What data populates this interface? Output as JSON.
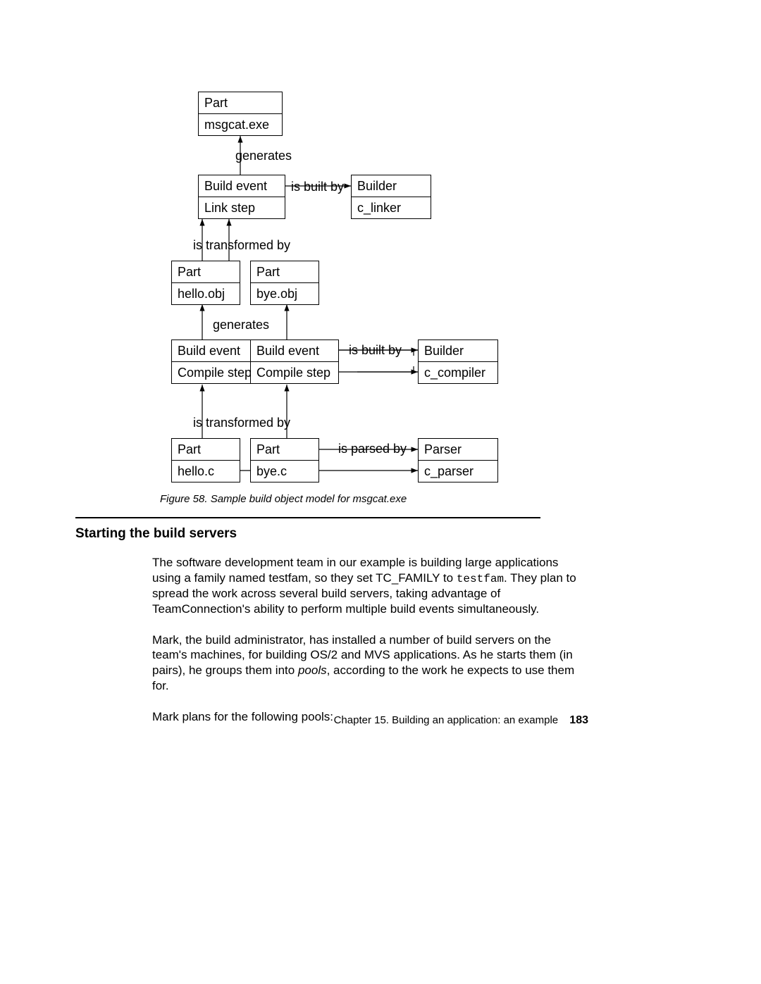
{
  "diagram": {
    "nodes": {
      "part_msgcat": {
        "top": "Part",
        "bottom": "msgcat.exe"
      },
      "link_step": {
        "top": "Build event",
        "bottom": "Link step"
      },
      "builder_link": {
        "top": "Builder",
        "bottom": "c_linker"
      },
      "part_hello_obj": {
        "top": "Part",
        "bottom": "hello.obj"
      },
      "part_bye_obj": {
        "top": "Part",
        "bottom": "bye.obj"
      },
      "compile_hello": {
        "top": "Build event",
        "bottom": "Compile step"
      },
      "compile_bye": {
        "top": "Build event",
        "bottom": "Compile step"
      },
      "builder_comp": {
        "top": "Builder",
        "bottom": "c_compiler"
      },
      "part_hello_c": {
        "top": "Part",
        "bottom": "hello.c"
      },
      "part_bye_c": {
        "top": "Part",
        "bottom": "bye.c"
      },
      "parser": {
        "top": "Parser",
        "bottom": "c_parser"
      }
    },
    "labels": {
      "generates1": "generates",
      "is_built_by1": "is built by",
      "transformed1": "is transformed by",
      "generates2": "generates",
      "is_built_by2": "is built by",
      "transformed2": "is transformed by",
      "is_parsed_by": "is parsed by"
    }
  },
  "caption": "Figure 58. Sample build object model for msgcat.exe",
  "heading": "Starting the build servers",
  "para1_a": "The software development team in our example is building large applications using a family named testfam, so they set TC_FAMILY to ",
  "para1_code": "testfam",
  "para1_b": ". They plan to spread the work across several build servers, taking advantage of TeamConnection's ability to perform multiple build events simultaneously.",
  "para2_a": "Mark, the build administrator, has installed a number of build servers on the team's machines, for building OS/2 and MVS applications. As he starts them (in pairs), he groups them into ",
  "para2_i": "pools",
  "para2_b": ", according to the work he expects to use them for.",
  "para3": "Mark plans for the following pools:",
  "footer_chapter": "Chapter 15. Building an application: an example",
  "page_number": "183"
}
